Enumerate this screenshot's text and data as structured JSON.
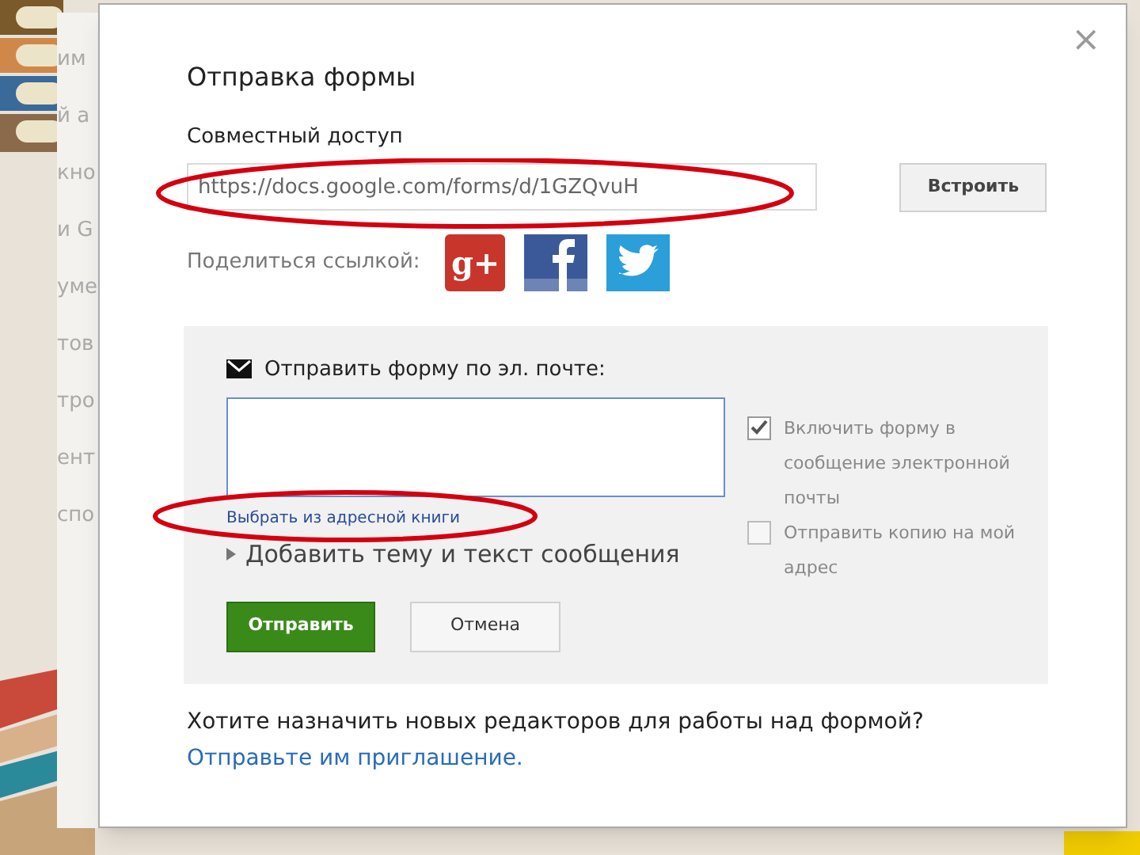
{
  "background_fragments": [
    "им",
    "й а",
    "кно",
    "и G",
    "уме",
    "тов",
    "тро",
    "ент",
    "спо"
  ],
  "dialog": {
    "title": "Отправка формы",
    "close": "×",
    "share_heading": "Совместный доступ",
    "link_field": {
      "value": "https://docs.google.com/forms/d/1GZQvuH"
    },
    "embed_button": "Встроить",
    "share_label": "Поделиться ссылкой:",
    "share_services": [
      {
        "kind": "gplus",
        "glyph": "g+"
      },
      {
        "kind": "facebook"
      },
      {
        "kind": "twitter"
      }
    ],
    "email": {
      "heading": "Отправить форму по эл. почте:",
      "address_book_link": "Выбрать из адресной книги",
      "add_subject": {
        "label": "Добавить тему и текст сообщения",
        "expanded": false
      },
      "options": [
        {
          "label": "Включить форму в сообщение электронной почты",
          "checked": true
        },
        {
          "label": "Отправить копию на мой адрес",
          "checked": false
        }
      ],
      "send_button": "Отправить",
      "cancel_button": "Отмена"
    },
    "footer_question": "Хотите назначить новых редакторов для работы над формой?",
    "footer_link": "Отправьте им приглашение."
  }
}
